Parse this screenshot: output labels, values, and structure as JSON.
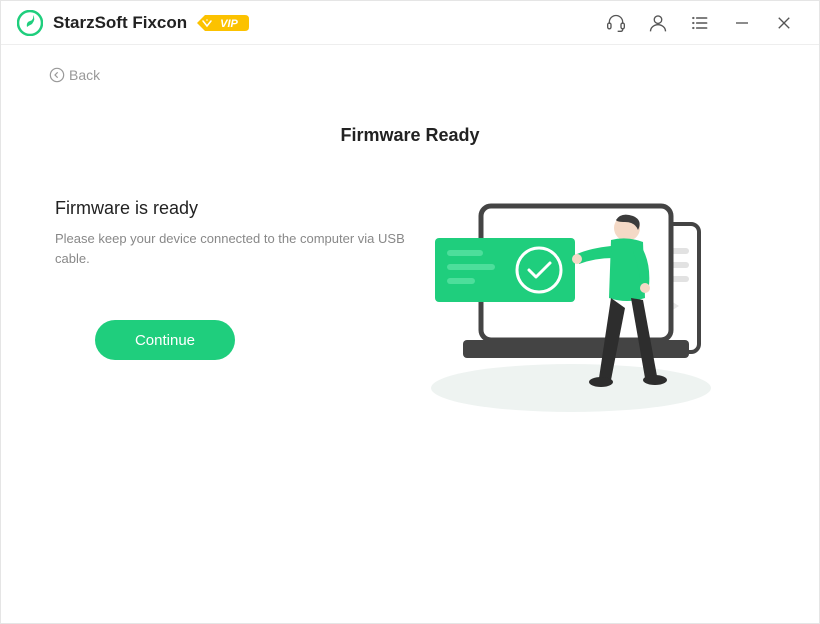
{
  "titlebar": {
    "app_name": "StarzSoft Fixcon",
    "vip_label": "VIP"
  },
  "nav": {
    "back_label": "Back"
  },
  "main": {
    "heading": "Firmware Ready",
    "sub_heading": "Firmware is ready",
    "instruction": "Please keep your device connected to the computer via USB cable.",
    "continue_label": "Continue"
  },
  "colors": {
    "accent": "#1fce7d",
    "vip_bg": "#fcc200"
  }
}
